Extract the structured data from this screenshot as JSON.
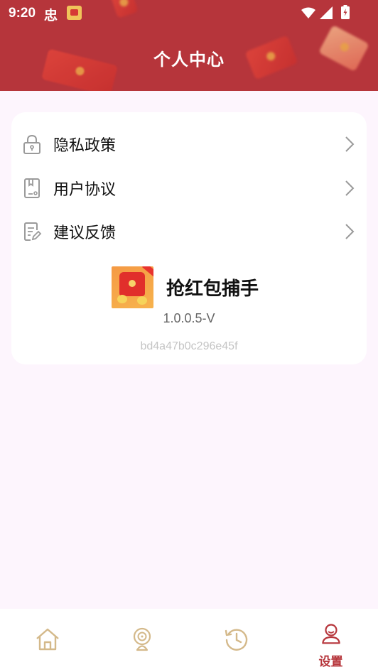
{
  "status_bar": {
    "time": "9:20",
    "carrier_glyph": "忠",
    "icons": [
      "app-notification-icon",
      "wifi-icon",
      "signal-icon",
      "battery-icon"
    ]
  },
  "header": {
    "title": "个人中心",
    "background_color": "#b6353b"
  },
  "menu": {
    "items": [
      {
        "label": "隐私政策",
        "icon": "lock-icon"
      },
      {
        "label": "用户协议",
        "icon": "document-icon"
      },
      {
        "label": "建议反馈",
        "icon": "edit-note-icon"
      }
    ]
  },
  "app_info": {
    "name": "抢红包捕手",
    "version": "1.0.0.5-V",
    "build_id": "bd4a47b0c296e45f"
  },
  "bottom_nav": {
    "items": [
      {
        "icon": "home-icon",
        "label": ""
      },
      {
        "icon": "radar-icon",
        "label": ""
      },
      {
        "icon": "history-icon",
        "label": ""
      },
      {
        "icon": "user-icon",
        "label": "设置",
        "active": true
      }
    ],
    "inactive_color": "#d4b98a",
    "active_color": "#b6353b"
  }
}
